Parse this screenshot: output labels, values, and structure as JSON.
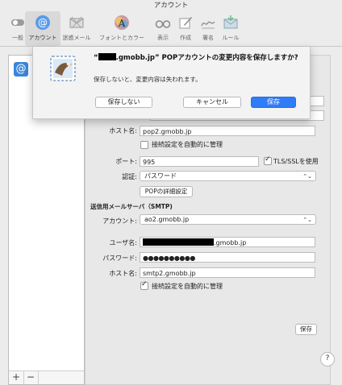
{
  "window": {
    "title": "アカウント"
  },
  "toolbar": {
    "items": [
      {
        "label": "一般",
        "icon": "general-switch-icon"
      },
      {
        "label": "アカウント",
        "icon": "at-sign-icon"
      },
      {
        "label": "迷惑メール",
        "icon": "junk-mail-icon"
      },
      {
        "label": "フォントとカラー",
        "icon": "font-color-icon"
      },
      {
        "label": "表示",
        "icon": "glasses-icon"
      },
      {
        "label": "作成",
        "icon": "compose-pen-icon"
      },
      {
        "label": "署名",
        "icon": "signature-icon"
      },
      {
        "label": "ルール",
        "icon": "rules-envelope-icon"
      }
    ],
    "active_index": 1
  },
  "sidebar": {
    "add_label": "+",
    "remove_label": "−"
  },
  "incoming": {
    "host_label": "ホスト名:",
    "host_value": "pop2.gmobb.jp",
    "auto_manage_label": "接続設定を自動的に管理",
    "auto_manage_checked": false,
    "port_label": "ポート:",
    "port_value": "995",
    "tls_label": "TLS/SSLを使用",
    "tls_checked": true,
    "auth_label": "認証:",
    "auth_value": "パスワード",
    "advanced_button": "POPの詳細設定"
  },
  "outgoing": {
    "section_title": "送信用メールサーバ（SMTP)",
    "account_label": "アカウント:",
    "account_value": "ao2.gmobb.jp",
    "username_label": "ユーザ名:",
    "username_suffix": ".gmobb.jp",
    "password_label": "パスワード:",
    "password_value": "●●●●●●●●●●",
    "host_label": "ホスト名:",
    "host_value": "smtp2.gmobb.jp",
    "auto_manage_label": "接続設定を自動的に管理",
    "auto_manage_checked": true
  },
  "save_button": "保存",
  "help_label": "?",
  "sheet": {
    "title_prefix": "“",
    "title_suffix": ".gmobb.jp” POPアカウントの変更内容を保存しますか?",
    "message": "保存しないと、変更内容は失われます。",
    "dont_save": "保存しない",
    "cancel": "キャンセル",
    "save": "保存",
    "accent_color": "#2f7cf6"
  }
}
